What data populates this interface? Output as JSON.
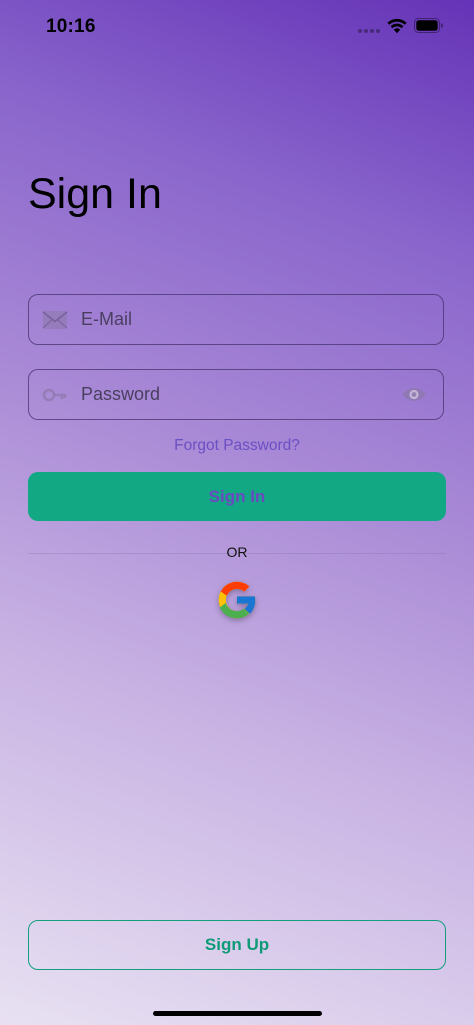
{
  "status_bar": {
    "time": "10:16",
    "icons": [
      "signal-dots-icon",
      "wifi-icon",
      "battery-icon"
    ]
  },
  "title": "Sign In",
  "form": {
    "email": {
      "placeholder": "E-Mail",
      "value": "",
      "icon": "envelope-icon"
    },
    "password": {
      "placeholder": "Password",
      "value": "",
      "icon": "key-icon",
      "toggle_icon": "eye-icon"
    },
    "forgot_password": "Forgot Password?",
    "submit_label": "Sign In"
  },
  "divider_label": "OR",
  "social": {
    "google_icon": "google-icon"
  },
  "signup_label": "Sign Up",
  "colors": {
    "primary_green": "#12a884",
    "accent_purple": "#6b4fc4",
    "gradient_top": "#6533b7",
    "gradient_bottom": "#e8e1f2"
  }
}
